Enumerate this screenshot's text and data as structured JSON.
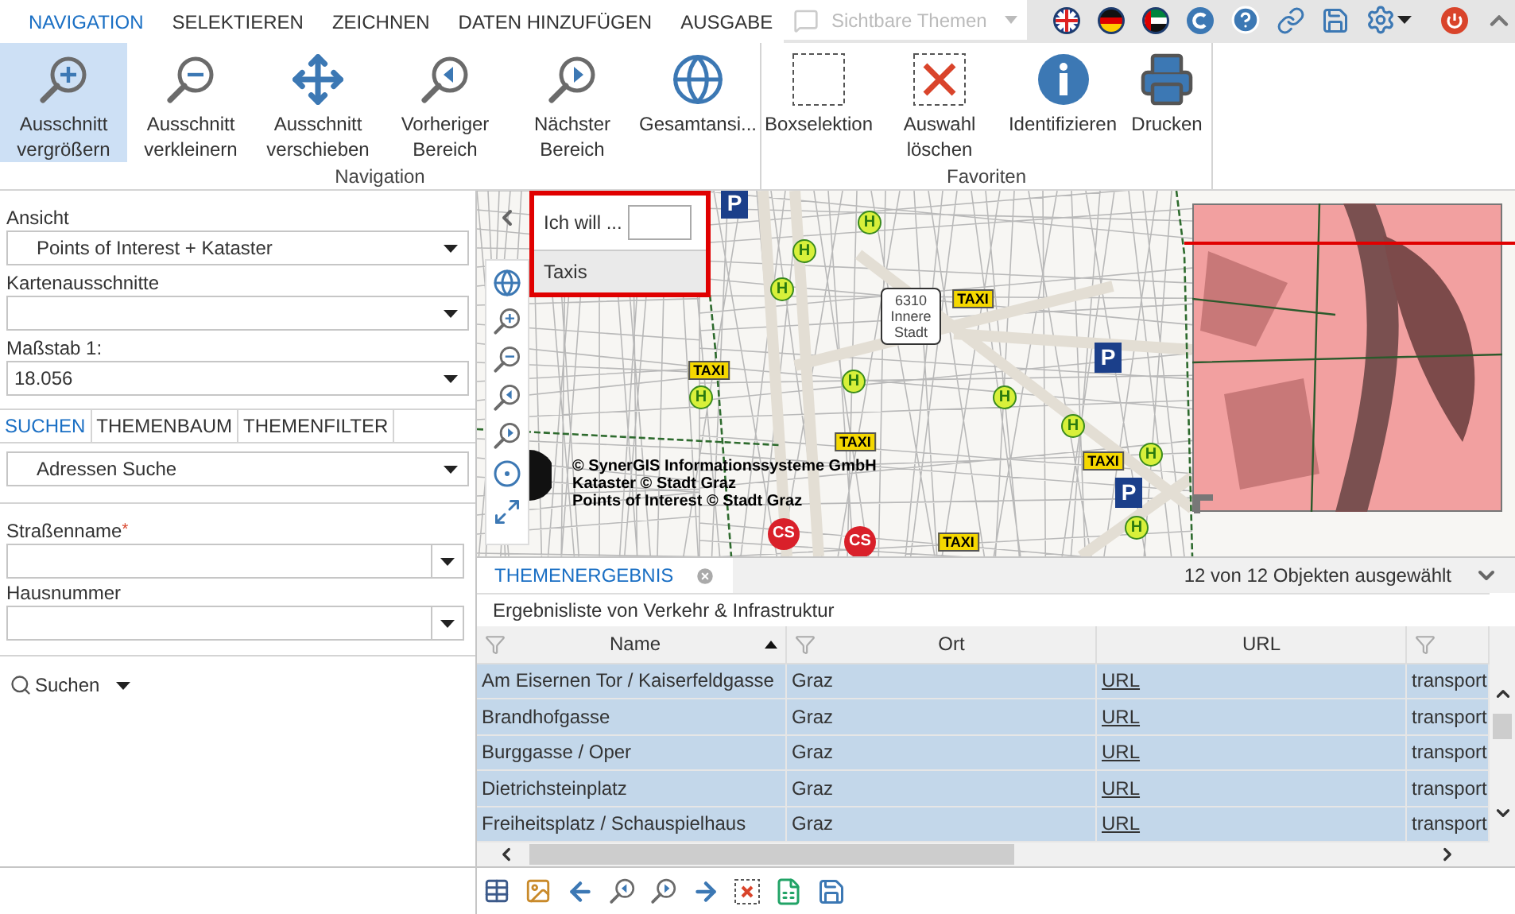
{
  "top_tabs": [
    {
      "label": "NAVIGATION",
      "selected": true
    },
    {
      "label": "SELEKTIEREN",
      "selected": false
    },
    {
      "label": "ZEICHNEN",
      "selected": false
    },
    {
      "label": "DATEN HINZUFÜGEN",
      "selected": false
    },
    {
      "label": "AUSGABE",
      "selected": false
    }
  ],
  "theme_select": {
    "placeholder": "Sichtbare Themen"
  },
  "ribbon": {
    "groups": [
      {
        "title": "Navigation",
        "buttons": [
          {
            "label": "Ausschnitt vergrößern",
            "selected": true
          },
          {
            "label": "Ausschnitt verkleinern",
            "selected": false
          },
          {
            "label": "Ausschnitt verschieben",
            "selected": false
          },
          {
            "label": "Vorheriger Bereich",
            "selected": false
          },
          {
            "label": "Nächster Bereich",
            "selected": false
          },
          {
            "label": "Gesamtansi...",
            "selected": false
          }
        ]
      },
      {
        "title": "Favoriten",
        "buttons": [
          {
            "label": "Boxselektion",
            "selected": false
          },
          {
            "label": "Auswahl löschen",
            "selected": false
          },
          {
            "label": "Identifizieren",
            "selected": false
          },
          {
            "label": "Drucken",
            "selected": false
          }
        ]
      }
    ]
  },
  "sidebar": {
    "view": {
      "label": "Ansicht",
      "value": "Points of Interest + Kataster"
    },
    "map_extracts": {
      "label": "Kartenausschnitte"
    },
    "scale": {
      "label": "Maßstab 1:",
      "value": "18.056"
    },
    "tabs": [
      {
        "label": "SUCHEN",
        "selected": true
      },
      {
        "label": "THEMENBAUM",
        "selected": false
      },
      {
        "label": "THEMENFILTER",
        "selected": false
      }
    ],
    "search_type": {
      "value": "Adressen Suche"
    },
    "fields": [
      {
        "label": "Straßenname",
        "required_mark": "*"
      },
      {
        "label": "Hausnummer"
      }
    ],
    "search_button": {
      "label": "Suchen"
    }
  },
  "map": {
    "popup": {
      "label": "Ich will ...",
      "option": "Taxis"
    },
    "district_label": "6310 Innere Stadt",
    "attribution": [
      "© SynerGIS Informationssysteme GmbH",
      "Kataster © Stadt Graz",
      "Points of Interest © Stadt Graz"
    ],
    "markers": [
      {
        "kind": "stop",
        "label": "H"
      },
      {
        "kind": "stop",
        "label": "H"
      },
      {
        "kind": "stop",
        "label": "H"
      },
      {
        "kind": "stop",
        "label": "H"
      },
      {
        "kind": "stop",
        "label": "H"
      },
      {
        "kind": "stop",
        "label": "H"
      },
      {
        "kind": "stop",
        "label": "H"
      },
      {
        "kind": "stop",
        "label": "H"
      },
      {
        "kind": "stop",
        "label": "H"
      },
      {
        "kind": "taxi",
        "label": "TAXI"
      },
      {
        "kind": "taxi",
        "label": "TAXI"
      },
      {
        "kind": "taxi",
        "label": "TAXI"
      },
      {
        "kind": "taxi",
        "label": "TAXI"
      },
      {
        "kind": "taxi",
        "label": "TAXI"
      },
      {
        "kind": "parking",
        "label": "P"
      },
      {
        "kind": "parking",
        "label": "P"
      },
      {
        "kind": "parking",
        "label": "P"
      },
      {
        "kind": "carsharing",
        "label": "CS"
      },
      {
        "kind": "carsharing",
        "label": "CS"
      }
    ]
  },
  "results": {
    "tabs": [
      {
        "label": "THEMENERGEBNIS",
        "selected": true
      }
    ],
    "selection_count": "12 von 12 Objekten ausgewählt",
    "subtitle": "Ergebnisliste von Verkehr & Infrastruktur",
    "table": {
      "columns": [
        {
          "label": "Name",
          "filter": true,
          "sorted_ascending": true
        },
        {
          "label": "Ort",
          "filter": true
        },
        {
          "label": "URL",
          "filter": false
        },
        {
          "filter": true
        }
      ],
      "rows": [
        {
          "selected": true,
          "cells": [
            "Am Eisernen Tor / Kaiserfeldgasse",
            "Graz",
            "URL",
            "transport"
          ]
        },
        {
          "selected": true,
          "cells": [
            "Brandhofgasse",
            "Graz",
            "URL",
            "transport"
          ]
        },
        {
          "selected": true,
          "cells": [
            "Burggasse / Oper",
            "Graz",
            "URL",
            "transport"
          ]
        },
        {
          "selected": true,
          "cells": [
            "Dietrichsteinplatz",
            "Graz",
            "URL",
            "transport"
          ]
        },
        {
          "selected": true,
          "cells": [
            "Freiheitsplatz / Schauspielhaus",
            "Graz",
            "URL",
            "transport"
          ]
        }
      ]
    }
  }
}
